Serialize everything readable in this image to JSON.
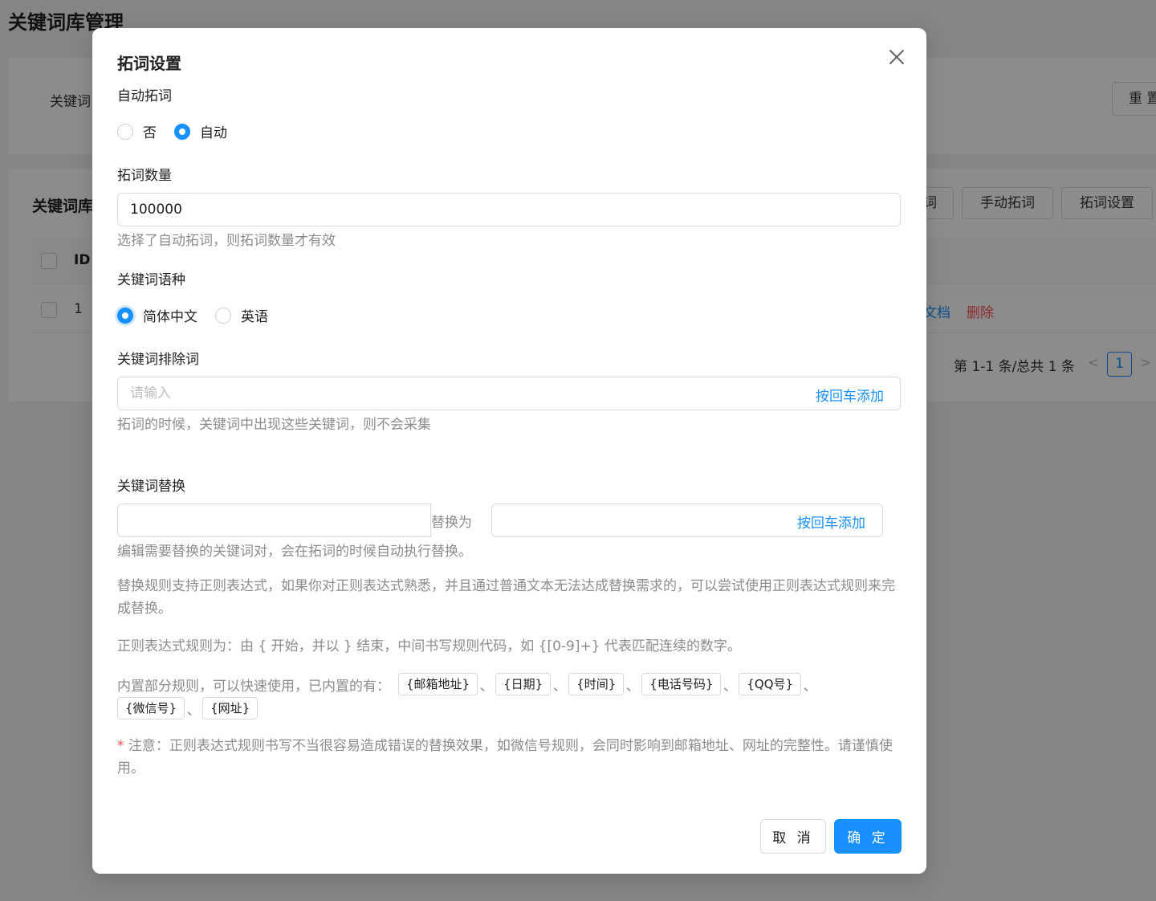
{
  "background": {
    "page_title": "关键词库管理",
    "search_label": "关键词",
    "reset_button": "重 置",
    "table_title": "关键词库",
    "buttons": {
      "partial": "词",
      "manual": "手动拓词",
      "settings": "拓词设置"
    },
    "table": {
      "header_id": "ID",
      "row_id": "1",
      "link_doc": "文档",
      "link_delete": "删除"
    },
    "pager": {
      "summary": "第 1-1 条/总共 1 条",
      "prev": "<",
      "current": "1",
      "next": ">"
    }
  },
  "modal": {
    "title": "拓词设置",
    "auto_expand": {
      "label": "自动拓词",
      "options": [
        {
          "label": "否",
          "checked": false
        },
        {
          "label": "自动",
          "checked": true
        }
      ]
    },
    "expand_count": {
      "label": "拓词数量",
      "value": "100000",
      "hint": "选择了自动拓词，则拓词数量才有效"
    },
    "language": {
      "label": "关键词语种",
      "options": [
        {
          "label": "简体中文",
          "checked": true
        },
        {
          "label": "英语",
          "checked": false
        }
      ]
    },
    "exclude": {
      "label": "关键词排除词",
      "placeholder": "请输入",
      "suffix": "按回车添加",
      "hint": "拓词的时候，关键词中出现这些关键词，则不会采集"
    },
    "replace": {
      "label": "关键词替换",
      "middle": "替换为",
      "suffix": "按回车添加",
      "hint": "编辑需要替换的关键词对，会在拓词的时候自动执行替换。",
      "regex_desc": "替换规则支持正则表达式，如果你对正则表达式熟悉，并且通过普通文本无法达成替换需求的，可以尝试使用正则表达式规则来完成替换。",
      "regex_syntax": "正则表达式规则为：由 { 开始，并以 } 结束，中间书写规则代码，如 {[0-9]+} 代表匹配连续的数字。",
      "builtin_prefix": "内置部分规则，可以快速使用，已内置的有：",
      "separator": "、",
      "builtin_tags": [
        "{邮箱地址}",
        "{日期}",
        "{时间}",
        "{电话号码}",
        "{QQ号}",
        "{微信号}",
        "{网址}"
      ],
      "note_star": "*",
      "note": " 注意：正则表达式规则书写不当很容易造成错误的替换效果，如微信号规则，会同时影响到邮箱地址、网址的完整性。请谨慎使用。"
    },
    "footer": {
      "cancel": "取 消",
      "ok": "确 定"
    }
  },
  "colors": {
    "primary": "#1890ff",
    "danger": "#ff4d4f",
    "hint": "#8c8c8c",
    "mask": "rgba(0,0,0,0.45)"
  }
}
